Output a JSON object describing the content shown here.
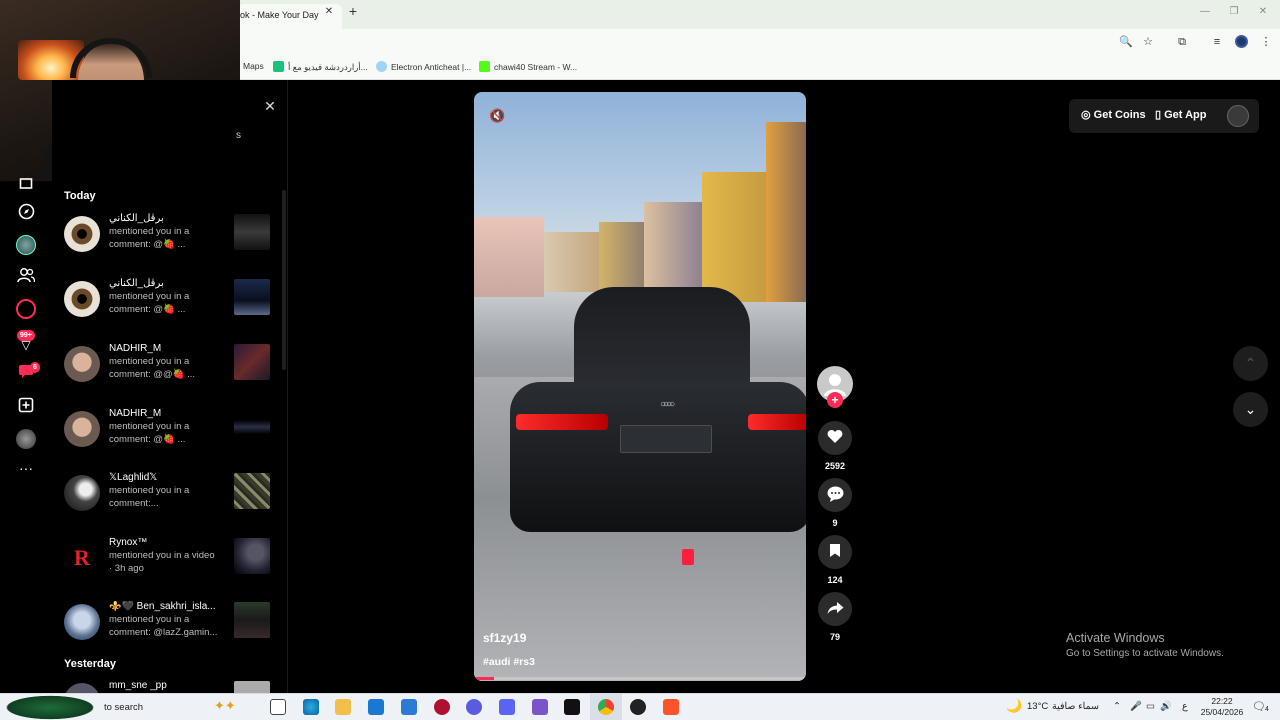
{
  "browser": {
    "tab_title": "ok - Make Your Day",
    "tab_close": "✕",
    "new_tab": "+",
    "window_controls": [
      "—",
      "❐",
      "✕"
    ],
    "toolbar_icons": [
      "🔍",
      "☆",
      "⧉",
      "≡",
      "⋮"
    ],
    "bookmarks": [
      {
        "label": "Maps",
        "color": "#f7faf6"
      },
      {
        "label": "أراردردشة فيديو مع أ...",
        "color": "#19c37d"
      },
      {
        "label": "Electron Anticheat |...",
        "color": "#9fd4f7"
      },
      {
        "label": "chawi40 Stream - W...",
        "color": "#53fc18"
      }
    ]
  },
  "sidebar": {
    "icons": [
      "home-icon",
      "explore-icon",
      "following-avatar",
      "friends-icon",
      "live-icon",
      "activity-icon",
      "messages-icon",
      "upload-icon",
      "profile-icon",
      "more-icon"
    ],
    "activity_badge": "99+",
    "messages_badge": "6",
    "more_label": "···"
  },
  "notifications": {
    "close": "✕",
    "header_fragment": "s",
    "sections": {
      "today": "Today",
      "yesterday": "Yesterday"
    },
    "items": [
      {
        "name": "برڨل_الكناني",
        "text": "mentioned you in a\ncomment: @🍓 ..."
      },
      {
        "name": "برڨل_الكناني",
        "text": "mentioned you in a\ncomment: @🍓 ..."
      },
      {
        "name": "NADHIR_M",
        "text": "mentioned you in a\ncomment: @@🍓 ..."
      },
      {
        "name": "NADHIR_M",
        "text": "mentioned you in a\ncomment: @🍓 ..."
      },
      {
        "name": "𝕏Laghlid𝕏",
        "text": "mentioned you in a\ncomment:..."
      },
      {
        "name": "Rynox™",
        "text": "mentioned you in a video\n· 3h ago"
      },
      {
        "name": "⚜️🖤 Ben_sakhri_isla...",
        "text": "mentioned you in a\ncomment: @lazZ.gamin..."
      },
      {
        "name": "mm_sne _pp",
        "text": ""
      }
    ]
  },
  "video": {
    "author": "sf1zy19",
    "caption": "#audi #rs3",
    "mute_icon": "🔇",
    "progress": 0.06
  },
  "actions": {
    "follow": "+",
    "like_count": "2592",
    "comment_count": "9",
    "save_count": "124",
    "share_count": "79"
  },
  "header": {
    "get_coins": "Get Coins",
    "get_app": "Get App"
  },
  "nav": {
    "up": "⌃",
    "down": "⌄"
  },
  "watermark": {
    "title": "Activate Windows",
    "subtitle": "Go to Settings to activate Windows."
  },
  "taskbar": {
    "search": "to search",
    "weather_temp": "13°C",
    "weather_text": "سماء صافية",
    "lang": "ع",
    "time": "22:22",
    "date": "25/04/2026",
    "notification_count": "4"
  }
}
